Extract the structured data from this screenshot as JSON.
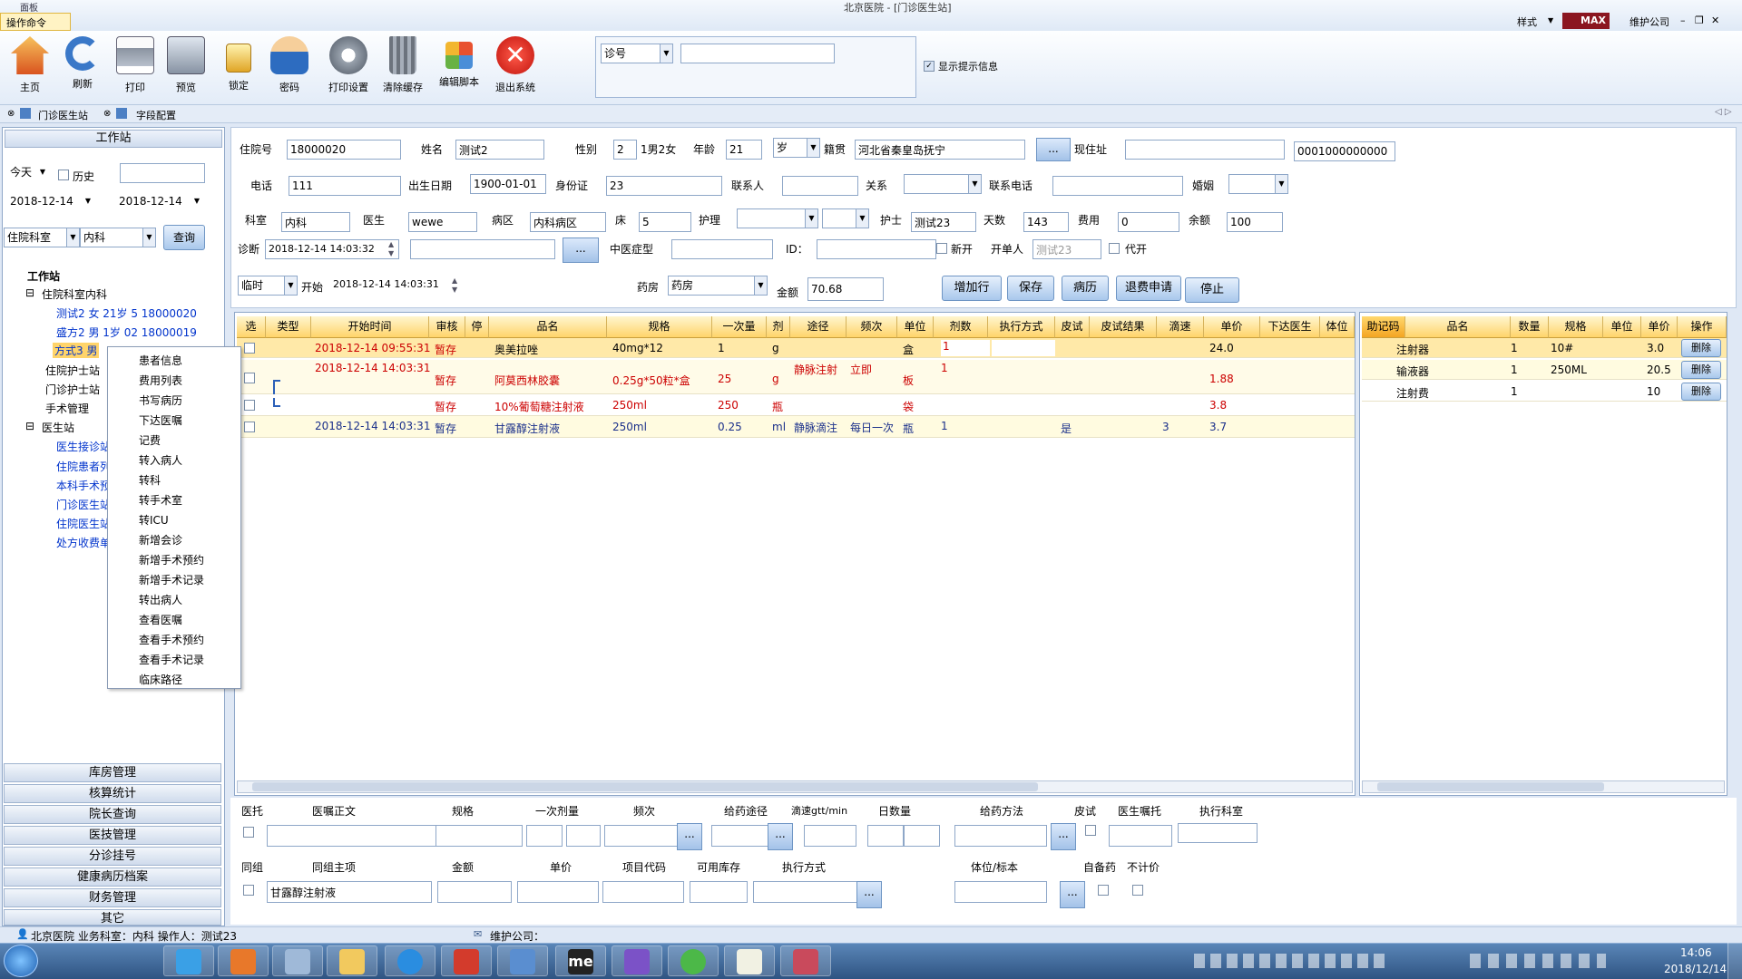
{
  "window": {
    "title": "北京医院 - [门诊医生站]",
    "panel_label": "面板",
    "ribbon_tab": "操作命令"
  },
  "top_right": {
    "style_label": "样式",
    "max_label": "MAX",
    "company": "维护公司"
  },
  "toolbar": {
    "buttons": [
      {
        "label": "主页",
        "icon": "home-icon"
      },
      {
        "label": "刷新",
        "icon": "refresh-icon"
      },
      {
        "label": "打印",
        "icon": "printer-icon"
      },
      {
        "label": "预览",
        "icon": "preview-icon"
      },
      {
        "label": "锁定",
        "icon": "lock-icon"
      },
      {
        "label": "密码",
        "icon": "user-key-icon"
      },
      {
        "label": "打印设置",
        "icon": "gear-icon"
      },
      {
        "label": "清除缓存",
        "icon": "trash-icon"
      },
      {
        "label": "编辑脚本",
        "icon": "blocks-icon"
      },
      {
        "label": "退出系统",
        "icon": "exit-icon"
      }
    ],
    "lookup_type": "诊号",
    "lookup_value": "",
    "show_hint_label": "显示提示信息"
  },
  "doc_tabs": [
    "门诊医生站",
    "字段配置"
  ],
  "left": {
    "header": "工作站",
    "date_preset": "今天",
    "history_label": "历史",
    "date_from": "2018-12-14",
    "date_to": "2018-12-14",
    "dept_type": "住院科室",
    "dept": "内科",
    "query_label": "查询",
    "tree": {
      "root": "工作站",
      "n1": "住院科室内科",
      "p1": "测试2 女 21岁 5 18000020",
      "p2": "盛方2 男 1岁 02 18000019",
      "p3": "方式3 男",
      "n2": "住院护士站",
      "n3": "门诊护士站",
      "n4": "手术管理",
      "n5": "医生站",
      "c1": "医生接诊站",
      "c2": "住院患者列",
      "c3": "本科手术预",
      "c4": "门诊医生站",
      "c5": "住院医生站",
      "c6": "处方收费单"
    },
    "nav": [
      "库房管理",
      "核算统计",
      "院长查询",
      "医技管理",
      "分诊挂号",
      "健康病历档案",
      "财务管理",
      "其它"
    ]
  },
  "context_menu": [
    "患者信息",
    "费用列表",
    "书写病历",
    "下达医嘱",
    "记费",
    "转入病人",
    "转科",
    "转手术室",
    "转ICU",
    "新增会诊",
    "新增手术预约",
    "新增手术记录",
    "转出病人",
    "查看医嘱",
    "查看手术预约",
    "查看手术记录",
    "临床路径"
  ],
  "form": {
    "l_inpatient_no": "住院号",
    "inpatient_no": "18000020",
    "l_name": "姓名",
    "name": "测试2",
    "l_gender": "性别",
    "gender": "2",
    "gender_hint": "1男2女",
    "l_age": "年龄",
    "age": "21",
    "age_unit": "岁",
    "l_native": "籍贯",
    "native": "河北省秦皇岛抚宁",
    "l_address": "现住址",
    "address": "",
    "code": "0001000000000",
    "l_phone": "电话",
    "phone": "111",
    "l_birth": "出生日期",
    "birth": "1900-01-01",
    "l_idcard": "身份证",
    "idcard": "23",
    "l_contact": "联系人",
    "contact": "",
    "l_relation": "关系",
    "relation": "",
    "l_contact_phone": "联系电话",
    "contact_phone": "",
    "l_marriage": "婚姻",
    "marriage": "",
    "l_dept": "科室",
    "dept": "内科",
    "l_doctor": "医生",
    "doctor": "wewe",
    "l_ward": "病区",
    "ward": "内科病区",
    "l_bed": "床",
    "bed": "5",
    "l_nursing": "护理",
    "nursing": "",
    "nursing2": "",
    "l_nurse": "护士",
    "nurse": "测试23",
    "l_days": "天数",
    "days": "143",
    "l_cost": "费用",
    "cost": "0",
    "l_balance": "余额",
    "balance": "100",
    "l_diag": "诊断",
    "diag_time": "2018-12-14 14:03:32",
    "diag": "",
    "l_tcm": "中医症型",
    "tcm": "",
    "l_id": "ID：",
    "id": "",
    "l_new": "新开",
    "l_issuer": "开单人",
    "issuer": "测试23",
    "l_proxy": "代开",
    "order_type": "临时",
    "l_start": "开始",
    "start": "2018-12-14 14:03:31",
    "l_pharmacy": "药房",
    "pharmacy": "药房",
    "l_amount": "金额",
    "amount": "70.68",
    "buttons": [
      "增加行",
      "保存",
      "病历",
      "退费申请",
      "停止"
    ]
  },
  "orders": {
    "headers": [
      "选",
      "类型",
      "开始时间",
      "审核",
      "停",
      "品名",
      "规格",
      "一次量",
      "剂",
      "途径",
      "频次",
      "单位",
      "剂数",
      "执行方式",
      "皮试",
      "皮试结果",
      "滴速",
      "单价",
      "下达医生",
      "体位"
    ],
    "rows": [
      {
        "time": "2018-12-14 09:55:31",
        "status": "暂存",
        "name": "奥美拉唑",
        "spec": "40mg*12",
        "dose": "1",
        "unit": "g",
        "route": "",
        "freq": "",
        "pack": "盒",
        "count": "1",
        "skin": "",
        "drip": "",
        "price": "24.0"
      },
      {
        "time": "2018-12-14 14:03:31",
        "status": "暂存",
        "name": "阿莫西林胶囊",
        "spec": "0.25g*50粒*盒",
        "dose": "25",
        "unit": "g",
        "route": "静脉注射",
        "freq": "立即",
        "pack": "板",
        "count": "1",
        "skin": "",
        "drip": "",
        "price": "1.88"
      },
      {
        "time": "",
        "status": "暂存",
        "name": "10%葡萄糖注射液",
        "spec": "250ml",
        "dose": "250",
        "unit": "瓶",
        "route": "",
        "freq": "",
        "pack": "袋",
        "count": "",
        "skin": "",
        "drip": "",
        "price": "3.8"
      },
      {
        "time": "2018-12-14 14:03:31",
        "status": "暂存",
        "name": "甘露醇注射液",
        "spec": "250ml",
        "dose": "0.25",
        "unit": "ml",
        "route": "静脉滴注",
        "freq": "每日一次",
        "pack": "瓶",
        "count": "1",
        "skin": "是",
        "drip": "3",
        "price": "3.7"
      }
    ]
  },
  "fees": {
    "headers": [
      "助记码",
      "品名",
      "数量",
      "规格",
      "单位",
      "单价",
      "操作"
    ],
    "rows": [
      {
        "name": "注射器",
        "qty": "1",
        "spec": "10#",
        "unit": "",
        "price": "3.0",
        "op": "删除"
      },
      {
        "name": "输液器",
        "qty": "1",
        "spec": "250ML",
        "unit": "",
        "price": "20.5",
        "op": "删除"
      },
      {
        "name": "注射费",
        "qty": "1",
        "spec": "",
        "unit": "",
        "price": "10",
        "op": "删除"
      }
    ]
  },
  "detail": {
    "row1_labels": [
      "医托",
      "医嘱正文",
      "规格",
      "一次剂量",
      "频次",
      "给药途径",
      "滴速gtt/min",
      "日数量",
      "给药方法",
      "皮试",
      "医生嘱托",
      "执行科室"
    ],
    "row2_labels": [
      "同组",
      "同组主项",
      "金额",
      "单价",
      "项目代码",
      "可用库存",
      "执行方式",
      "体位/标本",
      "自备药",
      "不计价"
    ],
    "group_main": "甘露醇注射液"
  },
  "status": {
    "hospital": "北京医院",
    "dept_label": "业务科室：",
    "dept": "内科",
    "operator_label": "操作人：",
    "operator": "测试23",
    "company": "维护公司："
  },
  "clock": {
    "time": "14:06",
    "date": "2018/12/14"
  },
  "colors": {
    "accent": "#ffd46a",
    "link_blue": "#0033cc",
    "danger_text": "#cc0000",
    "taskbar": "#3b6392"
  }
}
